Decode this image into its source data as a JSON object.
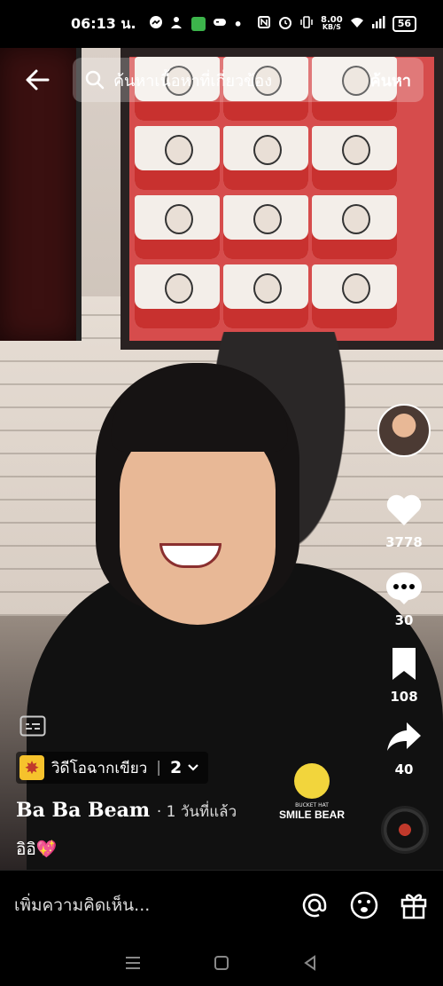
{
  "status_bar": {
    "time": "06:13 น.",
    "net_speed_value": "8.00",
    "net_speed_unit": "KB/S",
    "battery": "56"
  },
  "search": {
    "placeholder": "ค้นหาเนื้อหาที่เกี่ยวข้อง",
    "button_label": "ค้นหา"
  },
  "actions": {
    "likes": "3778",
    "comments": "30",
    "saves": "108",
    "shares": "40"
  },
  "video_info": {
    "series_title": "วิดีโอฉากเขียว",
    "series_part": "2",
    "author": "Ba Ba Beam",
    "posted": "· 1 วันที่แล้ว",
    "caption": "อิอิ💖"
  },
  "shirt_logo": {
    "line1": "BUCKET HAT",
    "line2": "SMILE BEAR"
  },
  "comment_bar": {
    "placeholder": "เพิ่มความคิดเห็น..."
  },
  "colors": {
    "accent_heart": "#ffffff",
    "series_badge": "#f6c22c"
  }
}
